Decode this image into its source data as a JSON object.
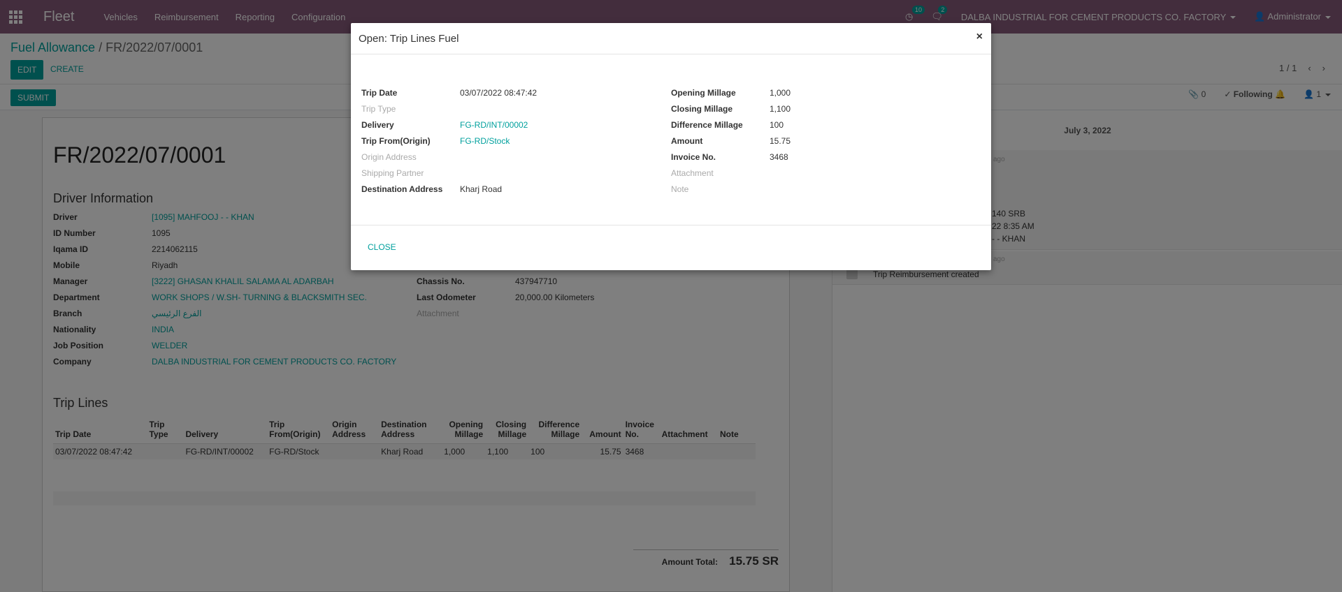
{
  "navbar": {
    "brand": "Fleet",
    "menu": [
      "Vehicles",
      "Reimbursement",
      "Reporting",
      "Configuration"
    ],
    "activity_count": "10",
    "message_count": "2",
    "company": "DALBA INDUSTRIAL FOR CEMENT PRODUCTS CO. FACTORY",
    "user": "Administrator"
  },
  "control_panel": {
    "breadcrumb_parent": "Fuel Allowance",
    "breadcrumb_sep": "/",
    "breadcrumb_current": "FR/2022/07/0001",
    "edit_label": "EDIT",
    "create_label": "CREATE",
    "submit_label": "SUBMIT",
    "pager": "1 / 1",
    "attachments_count": "0",
    "following_label": "Following",
    "followers_count": "1"
  },
  "form": {
    "title": "FR/2022/07/0001",
    "driver_section": "Driver Information",
    "driver_fields": [
      {
        "label": "Driver",
        "value": "[1095] MAHFOOJ - - KHAN"
      },
      {
        "label": "ID Number",
        "value": "1095"
      },
      {
        "label": "Iqama ID",
        "value": "2214062115"
      },
      {
        "label": "Mobile",
        "value": "Riyadh"
      },
      {
        "label": "Manager",
        "value": "[3222] GHASAN KHALIL SALAMA AL ADARBAH"
      },
      {
        "label": "Department",
        "value": "WORK SHOPS / W.SH- TURNING & BLACKSMITH SEC."
      },
      {
        "label": "Branch",
        "value": "الفرع الرئيسي"
      },
      {
        "label": "Nationality",
        "value": "INDIA"
      },
      {
        "label": "Job Position",
        "value": "WELDER"
      },
      {
        "label": "Company",
        "value": "DALBA INDUSTRIAL FOR CEMENT PRODUCTS CO. FACTORY"
      }
    ],
    "vehicle_fields": [
      {
        "label": "Chassis No.",
        "value": "437947710"
      },
      {
        "label": "Last Odometer",
        "value": "20,000.00  Kilometers"
      },
      {
        "label": "Attachment",
        "value": ""
      }
    ],
    "trip_section": "Trip Lines",
    "trip_headers": [
      "Trip Date",
      "Trip Type",
      "Delivery",
      "Trip From(Origin)",
      "Origin Address",
      "Destination Address",
      "Opening Millage",
      "Closing Millage",
      "Difference Millage",
      "Amount",
      "Invoice No.",
      "Attachment",
      "Note"
    ],
    "trip_rows": [
      [
        "03/07/2022 08:47:42",
        "",
        "FG-RD/INT/00002",
        "FG-RD/Stock",
        "",
        "Kharj Road",
        "1,000",
        "1,100",
        "100",
        "15.75",
        "3468",
        "",
        ""
      ]
    ],
    "amount_total_label": "Amount Total:",
    "amount_total_value": "15.75 SR"
  },
  "chatter": {
    "date": "July 3, 2022",
    "msg1_lines": [
      "140 SRB",
      "22 8:35 AM",
      "- - KHAN"
    ],
    "msg1_time": "ago",
    "msg2_time": "ago",
    "msg2_text": "Trip Reimbursement created"
  },
  "modal": {
    "title": "Open: Trip Lines Fuel",
    "close_x": "×",
    "left_fields": [
      {
        "label": "Trip Date",
        "value": "03/07/2022 08:47:42"
      },
      {
        "label": "Trip Type",
        "value": ""
      },
      {
        "label": "Delivery",
        "value": "FG-RD/INT/00002"
      },
      {
        "label": "Trip From(Origin)",
        "value": "FG-RD/Stock"
      },
      {
        "label": "Origin Address",
        "value": ""
      },
      {
        "label": "Shipping Partner",
        "value": ""
      },
      {
        "label": "Destination Address",
        "value": "Kharj Road"
      }
    ],
    "right_fields": [
      {
        "label": "Opening Millage",
        "value": "1,000"
      },
      {
        "label": "Closing Millage",
        "value": "1,100"
      },
      {
        "label": "Difference Millage",
        "value": "100"
      },
      {
        "label": "Amount",
        "value": "15.75"
      },
      {
        "label": "Invoice No.",
        "value": "3468"
      },
      {
        "label": "Attachment",
        "value": ""
      },
      {
        "label": "Note",
        "value": ""
      }
    ],
    "close_label": "CLOSE"
  },
  "colors": {
    "navbar": "#875a7b",
    "accent": "#00a09d"
  }
}
